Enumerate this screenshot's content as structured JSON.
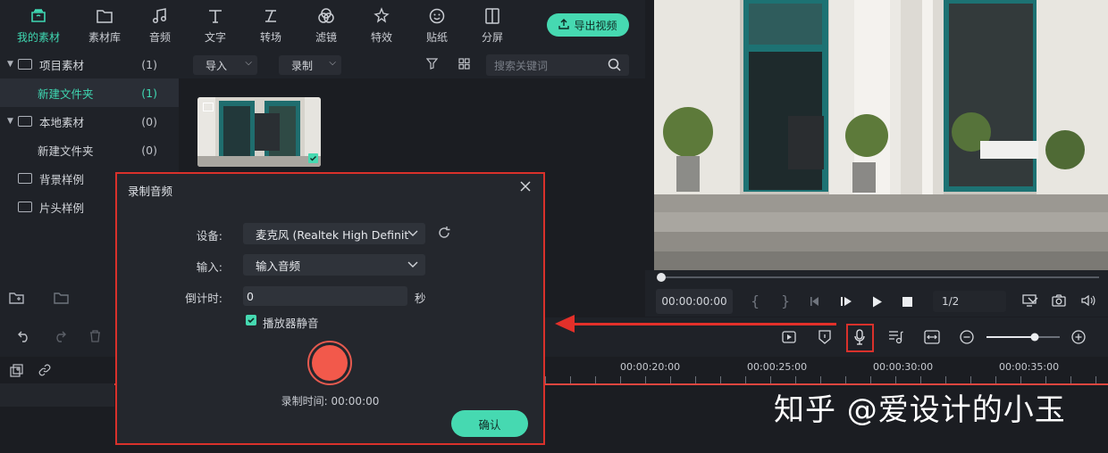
{
  "top_tabs": [
    {
      "label": "我的素材",
      "icon": "my-assets-icon"
    },
    {
      "label": "素材库",
      "icon": "folder-icon"
    },
    {
      "label": "音频",
      "icon": "music-icon"
    },
    {
      "label": "文字",
      "icon": "text-icon"
    },
    {
      "label": "转场",
      "icon": "transition-icon"
    },
    {
      "label": "滤镜",
      "icon": "filter-icon"
    },
    {
      "label": "特效",
      "icon": "effects-icon"
    },
    {
      "label": "贴纸",
      "icon": "sticker-icon"
    },
    {
      "label": "分屏",
      "icon": "split-screen-icon"
    }
  ],
  "export_button": "导出视频",
  "tree": [
    {
      "label": "项目素材",
      "count": "(1)"
    },
    {
      "label": "新建文件夹",
      "count": "(1)"
    },
    {
      "label": "本地素材",
      "count": "(0)"
    },
    {
      "label": "新建文件夹",
      "count": "(0)"
    },
    {
      "label": "背景样例",
      "count": ""
    },
    {
      "label": "片头样例",
      "count": ""
    }
  ],
  "media_toolbar": {
    "import_label": "导入",
    "record_label": "录制",
    "search_placeholder": "搜索关键词"
  },
  "player": {
    "timecode": "00:00:00:00",
    "ratio": "1/2"
  },
  "timeline": {
    "ticks": [
      "00:00:20:00",
      "00:00:25:00",
      "00:00:30:00",
      "00:00:35:00"
    ]
  },
  "dialog": {
    "title": "录制音频",
    "device_label": "设备:",
    "device_value": "麦克风 (Realtek High Definit",
    "input_label": "输入:",
    "input_value": "输入音频",
    "countdown_label": "倒计时:",
    "countdown_value": "0",
    "countdown_unit": "秒",
    "mute_label": "播放器静音",
    "mute_checked": true,
    "record_time_label": "录制时间:",
    "record_time_value": "00:00:00",
    "confirm_label": "确认"
  },
  "watermark": "知乎 @爱设计的小玉",
  "colors": {
    "accent": "#46d9b1",
    "highlight_red": "#d9312b",
    "record_red": "#f2594b"
  }
}
